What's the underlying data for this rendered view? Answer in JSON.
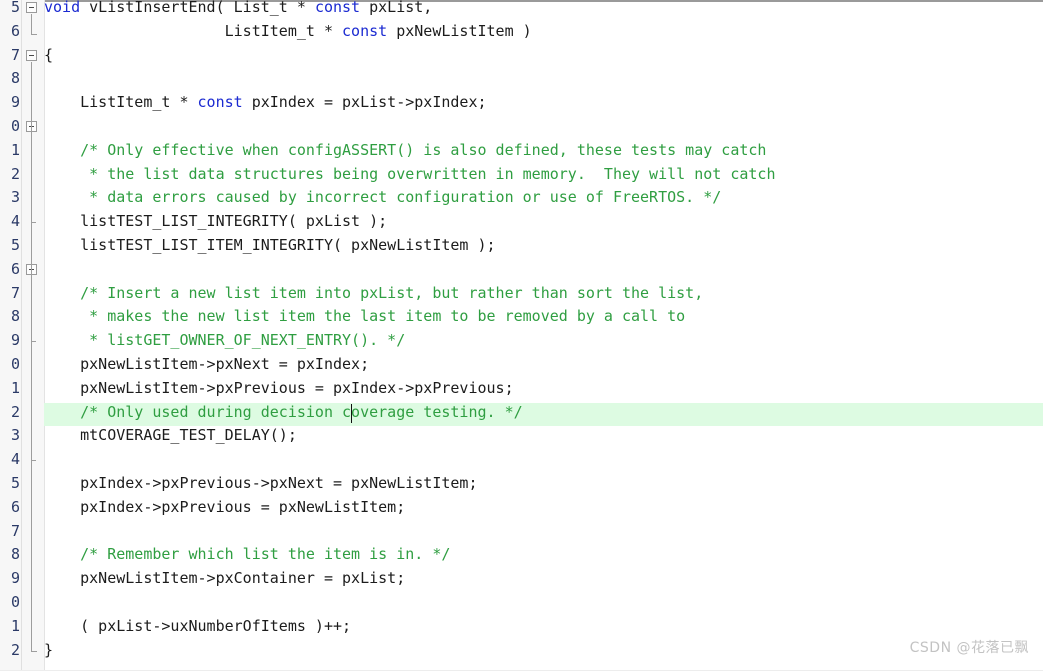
{
  "editor": {
    "language": "C",
    "theme": "light",
    "font_size_px": 15,
    "line_height_px": 23.8,
    "colors": {
      "background": "#ffffff",
      "gutter_background": "#f7f7f7",
      "line_number": "#2b3a67",
      "keyword": "#1b2ad1",
      "comment": "#2f9e41",
      "plain_text": "#1c1c1c",
      "current_line_highlight": "#ddfbe2",
      "fold_marker": "#9a9a9a",
      "caret": "#101010",
      "watermark": "#c3c3c3"
    },
    "current_line_index": 17,
    "caret": {
      "line_index": 17,
      "column_after_text": "    /* Only used during decision c"
    }
  },
  "gutter": {
    "note": "line numbers are clipped at the left edge of the screenshot; only the final digit of each number is visible",
    "line_numbers": [
      "5",
      "6",
      "7",
      "8",
      "9",
      "0",
      "1",
      "2",
      "3",
      "4",
      "5",
      "6",
      "7",
      "8",
      "9",
      "0",
      "1",
      "2",
      "3",
      "4",
      "5",
      "6",
      "7",
      "8",
      "9",
      "0",
      "1",
      "2"
    ]
  },
  "code": {
    "lines": [
      {
        "index": 0,
        "tokens": [
          {
            "t": "void",
            "c": "kw"
          },
          {
            "t": " vListInsertEnd( List_t * ",
            "c": "pln"
          },
          {
            "t": "const",
            "c": "kw"
          },
          {
            "t": " pxList,",
            "c": "pln"
          }
        ]
      },
      {
        "index": 1,
        "tokens": [
          {
            "t": "                    ListItem_t * ",
            "c": "pln"
          },
          {
            "t": "const",
            "c": "kw"
          },
          {
            "t": " pxNewListItem )",
            "c": "pln"
          }
        ]
      },
      {
        "index": 2,
        "tokens": [
          {
            "t": "{",
            "c": "br"
          }
        ]
      },
      {
        "index": 3,
        "tokens": [
          {
            "t": "",
            "c": "pln"
          }
        ]
      },
      {
        "index": 4,
        "tokens": [
          {
            "t": "    ListItem_t * ",
            "c": "pln"
          },
          {
            "t": "const",
            "c": "kw"
          },
          {
            "t": " pxIndex = pxList->pxIndex;",
            "c": "pln"
          }
        ]
      },
      {
        "index": 5,
        "tokens": [
          {
            "t": "",
            "c": "pln"
          }
        ]
      },
      {
        "index": 6,
        "tokens": [
          {
            "t": "    /* Only effective when configASSERT() is also defined, these tests may catch",
            "c": "com"
          }
        ]
      },
      {
        "index": 7,
        "tokens": [
          {
            "t": "     * the list data structures being overwritten in memory.  They will not catch",
            "c": "com"
          }
        ]
      },
      {
        "index": 8,
        "tokens": [
          {
            "t": "     * data errors caused by incorrect configuration or use of FreeRTOS. */",
            "c": "com"
          }
        ]
      },
      {
        "index": 9,
        "tokens": [
          {
            "t": "    listTEST_LIST_INTEGRITY( pxList );",
            "c": "pln"
          }
        ]
      },
      {
        "index": 10,
        "tokens": [
          {
            "t": "    listTEST_LIST_ITEM_INTEGRITY( pxNewListItem );",
            "c": "pln"
          }
        ]
      },
      {
        "index": 11,
        "tokens": [
          {
            "t": "",
            "c": "pln"
          }
        ]
      },
      {
        "index": 12,
        "tokens": [
          {
            "t": "    /* Insert a new list item into pxList, but rather than sort the list,",
            "c": "com"
          }
        ]
      },
      {
        "index": 13,
        "tokens": [
          {
            "t": "     * makes the new list item the last item to be removed by a call to",
            "c": "com"
          }
        ]
      },
      {
        "index": 14,
        "tokens": [
          {
            "t": "     * listGET_OWNER_OF_NEXT_ENTRY(). */",
            "c": "com"
          }
        ]
      },
      {
        "index": 15,
        "tokens": [
          {
            "t": "    pxNewListItem->pxNext = pxIndex;",
            "c": "pln"
          }
        ]
      },
      {
        "index": 16,
        "tokens": [
          {
            "t": "    pxNewListItem->pxPrevious = pxIndex->pxPrevious;",
            "c": "pln"
          }
        ]
      },
      {
        "index": 17,
        "tokens": [
          {
            "t": "    /* Only used during decision coverage testing. */",
            "c": "com"
          }
        ]
      },
      {
        "index": 18,
        "tokens": [
          {
            "t": "    mtCOVERAGE_TEST_DELAY();",
            "c": "pln"
          }
        ]
      },
      {
        "index": 19,
        "tokens": [
          {
            "t": "",
            "c": "pln"
          }
        ]
      },
      {
        "index": 20,
        "tokens": [
          {
            "t": "    pxIndex->pxPrevious->pxNext = pxNewListItem;",
            "c": "pln"
          }
        ]
      },
      {
        "index": 21,
        "tokens": [
          {
            "t": "    pxIndex->pxPrevious = pxNewListItem;",
            "c": "pln"
          }
        ]
      },
      {
        "index": 22,
        "tokens": [
          {
            "t": "",
            "c": "pln"
          }
        ]
      },
      {
        "index": 23,
        "tokens": [
          {
            "t": "    /* Remember which list the item is in. */",
            "c": "com"
          }
        ]
      },
      {
        "index": 24,
        "tokens": [
          {
            "t": "    pxNewListItem->pxContainer = pxList;",
            "c": "pln"
          }
        ]
      },
      {
        "index": 25,
        "tokens": [
          {
            "t": "",
            "c": "pln"
          }
        ]
      },
      {
        "index": 26,
        "tokens": [
          {
            "t": "    ( pxList->uxNumberOfItems )++;",
            "c": "pln"
          }
        ]
      },
      {
        "index": 27,
        "tokens": [
          {
            "t": "}",
            "c": "br"
          }
        ]
      }
    ]
  },
  "fold_markers": [
    {
      "line_index": 0,
      "type": "collapse-box"
    },
    {
      "line_index": 2,
      "type": "collapse-box"
    },
    {
      "line_index": 5,
      "type": "collapse-box"
    },
    {
      "line_index": 11,
      "type": "collapse-box"
    }
  ],
  "watermark": {
    "text": "CSDN @花落已飘"
  }
}
